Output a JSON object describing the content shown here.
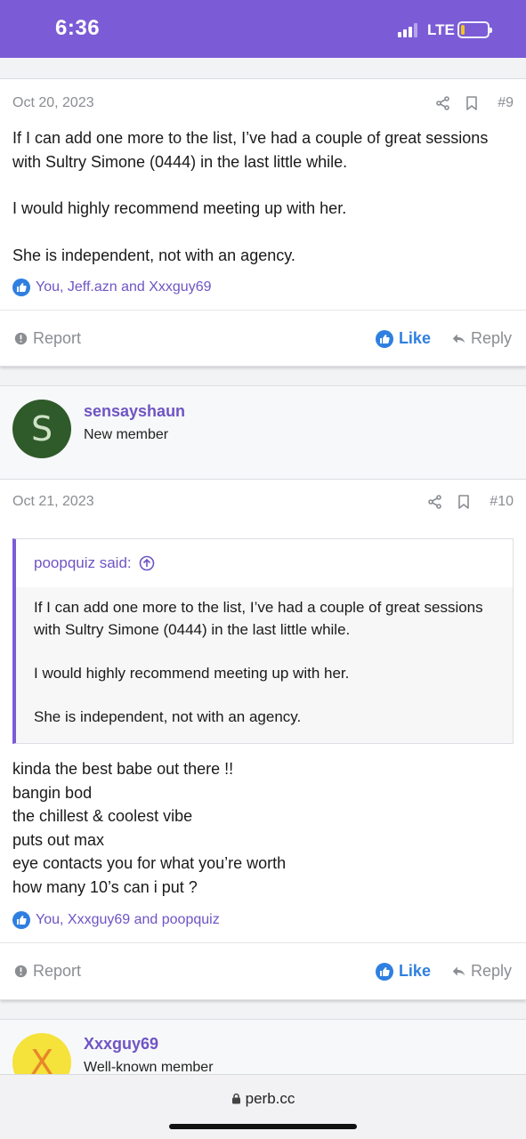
{
  "status_bar": {
    "time": "6:36",
    "network": "LTE",
    "battery_level": 0.15,
    "background": "#7b5cd6"
  },
  "post9": {
    "date": "Oct 20, 2023",
    "post_number": "#9",
    "paragraphs": [
      "If I can add one more to the list, I’ve had a couple of great sessions with Sultry Simone (0444) in the last little while.",
      "I would highly recommend meeting up with her.",
      "She is independent, not with an agency."
    ],
    "reactions": "You, Jeff.azn and Xxxguy69",
    "report_label": "Report",
    "like_label": "Like",
    "reply_label": "Reply"
  },
  "post10": {
    "username": "sensayshaun",
    "user_title": "New member",
    "avatar_letter": "S",
    "avatar_color": "#2f5a2a",
    "date": "Oct 21, 2023",
    "post_number": "#10",
    "quote": {
      "author_label": "poopquiz said:",
      "paragraphs": [
        "If I can add one more to the list, I’ve had a couple of great sessions with Sultry Simone (0444) in the last little while.",
        "I would highly recommend meeting up with her.",
        "She is independent, not with an agency."
      ]
    },
    "lines": [
      "kinda the best babe out there !!",
      "bangin bod",
      "the chillest & coolest vibe",
      "puts out max",
      "eye contacts you for what you’re worth",
      "how many 10’s can i put ?"
    ],
    "reactions": "You, Xxxguy69 and poopquiz",
    "report_label": "Report",
    "like_label": "Like",
    "reply_label": "Reply"
  },
  "post11": {
    "username": "Xxxguy69",
    "user_title": "Well-known member",
    "avatar_letter": "X",
    "avatar_color": "#f5e23a"
  },
  "browser": {
    "url": "perb.cc"
  },
  "colors": {
    "accent": "#7b5cd6",
    "link": "#6e55c4",
    "like_blue": "#2f7fe0"
  }
}
